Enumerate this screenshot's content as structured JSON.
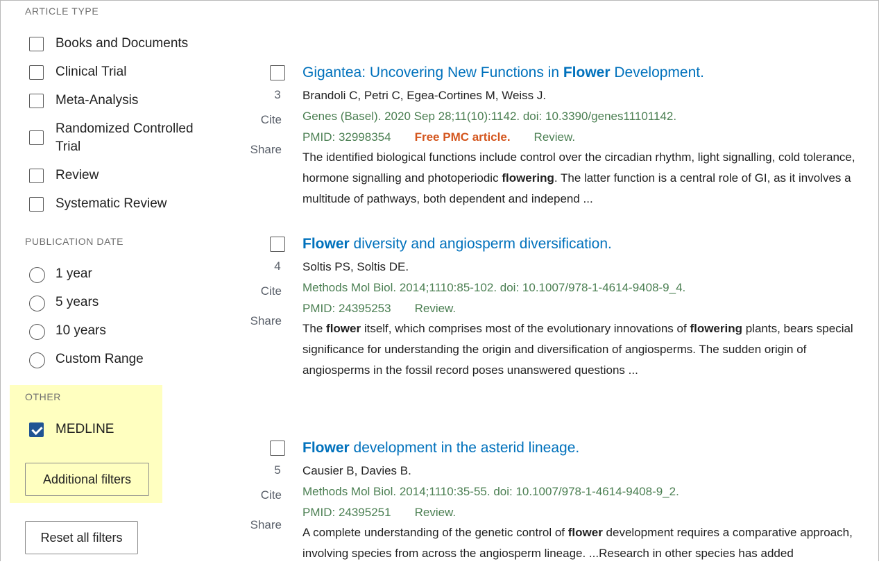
{
  "sidebar": {
    "article_type": {
      "title": "ARTICLE TYPE",
      "items": [
        {
          "label": "Books and Documents",
          "checked": false
        },
        {
          "label": "Clinical Trial",
          "checked": false
        },
        {
          "label": "Meta-Analysis",
          "checked": false
        },
        {
          "label": "Randomized Controlled Trial",
          "line1": "Randomized Controlled",
          "line2": "Trial",
          "checked": false
        },
        {
          "label": "Review",
          "checked": false
        },
        {
          "label": "Systematic Review",
          "checked": false
        }
      ]
    },
    "publication_date": {
      "title": "PUBLICATION DATE",
      "items": [
        {
          "label": "1 year"
        },
        {
          "label": "5 years"
        },
        {
          "label": "10 years"
        },
        {
          "label": "Custom Range"
        }
      ]
    },
    "other": {
      "title": "OTHER",
      "items": [
        {
          "label": "MEDLINE",
          "checked": true
        }
      ]
    },
    "additional_filters_label": "Additional filters",
    "reset_label": "Reset all filters",
    "highlight_color": "#ffffc0",
    "checked_color": "#205493"
  },
  "actions": {
    "cite": "Cite",
    "share": "Share"
  },
  "results": [
    {
      "number": "3",
      "title_pre": "Gigantea: Uncovering New Functions in ",
      "title_bold": "Flower",
      "title_post": " Development.",
      "authors": "Brandoli C, Petri C, Egea-Cortines M, Weiss J.",
      "citation": "Genes (Basel). 2020 Sep 28;11(10):1142. doi: 10.3390/genes11101142.",
      "pmid": "PMID: 32998354",
      "free_pmc": "Free PMC article.",
      "pub_type": "Review.",
      "snippet_parts": [
        {
          "t": "The identified biological functions include control over the circadian rhythm, light signalling, cold tolerance, hormone signalling and photoperiodic ",
          "b": false
        },
        {
          "t": "flowering",
          "b": true
        },
        {
          "t": ". The latter function is a central role of GI, as it involves a multitude of pathways, both dependent and independ ...",
          "b": false
        }
      ]
    },
    {
      "number": "4",
      "title_pre": "",
      "title_bold": "Flower",
      "title_post": " diversity and angiosperm diversification.",
      "authors": "Soltis PS, Soltis DE.",
      "citation": "Methods Mol Biol. 2014;1110:85-102. doi: 10.1007/978-1-4614-9408-9_4.",
      "pmid": "PMID: 24395253",
      "free_pmc": "",
      "pub_type": "Review.",
      "snippet_parts": [
        {
          "t": "The ",
          "b": false
        },
        {
          "t": "flower",
          "b": true
        },
        {
          "t": " itself, which comprises most of the evolutionary innovations of ",
          "b": false
        },
        {
          "t": "flowering",
          "b": true
        },
        {
          "t": " plants, bears special significance for understanding the origin and diversification of angiosperms. The sudden origin of angiosperms in the fossil record poses unanswered questions ...",
          "b": false
        }
      ]
    },
    {
      "number": "5",
      "title_pre": "",
      "title_bold": "Flower",
      "title_post": " development in the asterid lineage.",
      "authors": "Causier B, Davies B.",
      "citation": "Methods Mol Biol. 2014;1110:35-55. doi: 10.1007/978-1-4614-9408-9_2.",
      "pmid": "PMID: 24395251",
      "free_pmc": "",
      "pub_type": "Review.",
      "snippet_parts": [
        {
          "t": "A complete understanding of the genetic control of ",
          "b": false
        },
        {
          "t": "flower",
          "b": true
        },
        {
          "t": " development requires a comparative approach, involving species from across the angiosperm lineage. ...Research in other species has added",
          "b": false
        }
      ]
    }
  ]
}
